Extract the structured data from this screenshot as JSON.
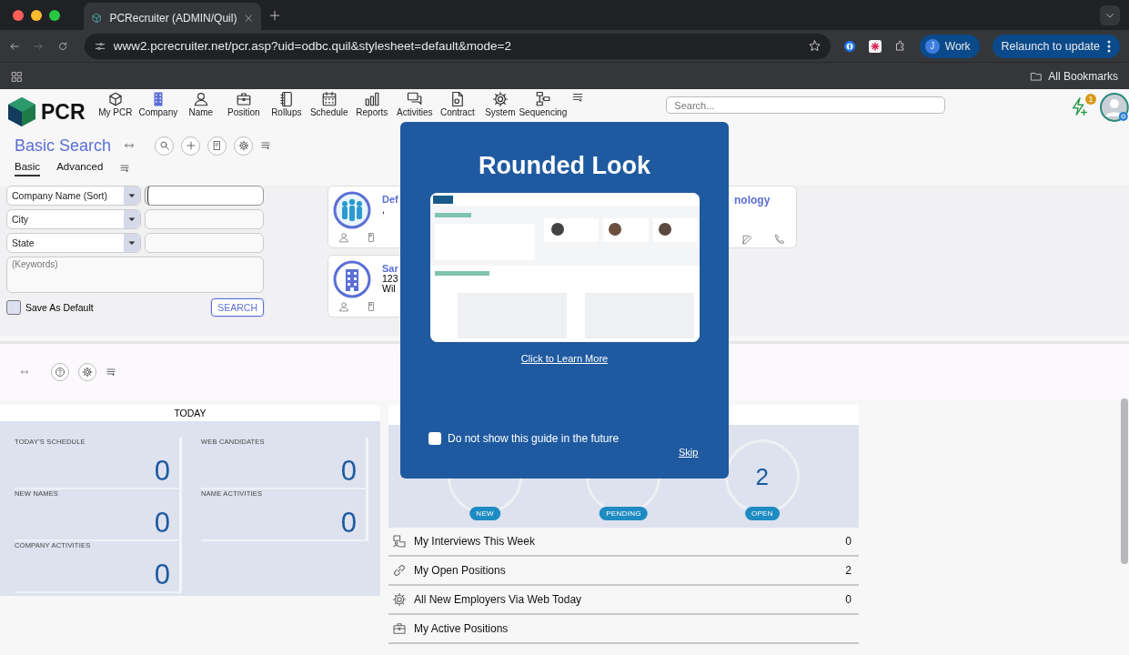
{
  "browser": {
    "tab_title": "PCRecruiter (ADMIN/Quil)",
    "url": "www2.pcrecruiter.net/pcr.asp?uid=odbc.quil&stylesheet=default&mode=2",
    "profile_initial": "J",
    "profile_name": "Work",
    "relaunch": "Relaunch to update",
    "bookmarks": "All Bookmarks"
  },
  "header": {
    "logo": "PCR",
    "nav": [
      {
        "label": "My PCR",
        "selected": false
      },
      {
        "label": "Company",
        "selected": true
      },
      {
        "label": "Name",
        "selected": false
      },
      {
        "label": "Position",
        "selected": false
      },
      {
        "label": "Rollups",
        "selected": false
      },
      {
        "label": "Schedule",
        "selected": false
      },
      {
        "label": "Reports",
        "selected": false
      },
      {
        "label": "Activities",
        "selected": false
      },
      {
        "label": "Contract",
        "selected": false
      },
      {
        "label": "System",
        "selected": false
      },
      {
        "label": "Sequencing",
        "selected": false
      }
    ],
    "search_placeholder": "Search...",
    "notification_count": "1"
  },
  "search": {
    "title": "Basic Search",
    "tabs": [
      {
        "label": "Basic",
        "selected": true
      },
      {
        "label": "Advanced",
        "selected": false
      }
    ],
    "fields": [
      {
        "selector": "Company Name (Sort)",
        "focused": true
      },
      {
        "selector": "City",
        "focused": false
      },
      {
        "selector": "State",
        "focused": false
      }
    ],
    "keywords_placeholder": "(Keywords)",
    "save_default": {
      "label": "Save As Default",
      "checked": false
    },
    "search_button": "SEARCH"
  },
  "results": [
    {
      "kind": "people",
      "title": "Def",
      "lines": [
        ","
      ]
    },
    {
      "kind": "company",
      "title": "Sar",
      "lines": [
        "123",
        "Wil"
      ]
    },
    {
      "kind": "partial",
      "title": "nology"
    }
  ],
  "today": {
    "title": "TODAY",
    "stats": [
      {
        "label": "TODAY'S SCHEDULE",
        "value": "0"
      },
      {
        "label": "WEB CANDIDATES",
        "value": "0"
      },
      {
        "label": "NEW NAMES",
        "value": "0"
      },
      {
        "label": "NAME ACTIVITIES",
        "value": "0"
      },
      {
        "label": "COMPANY ACTIVITIES",
        "value": "0"
      }
    ]
  },
  "positions": {
    "circles": [
      {
        "label": "NEW"
      },
      {
        "label": "PENDING"
      },
      {
        "label": "OPEN",
        "value": "2"
      }
    ],
    "list": [
      {
        "kind": "interview",
        "label": "My Interviews This Week",
        "count": "0"
      },
      {
        "kind": "link",
        "label": "My Open Positions",
        "count": "2"
      },
      {
        "kind": "gear",
        "label": "All New Employers Via Web Today",
        "count": "0"
      },
      {
        "kind": "briefcase",
        "label": "My Active Positions"
      }
    ]
  },
  "guide": {
    "title": "Rounded Look",
    "link": "Click to Learn More",
    "dont_show": {
      "label": "Do not show this guide in the future",
      "checked": false
    },
    "skip": "Skip"
  }
}
